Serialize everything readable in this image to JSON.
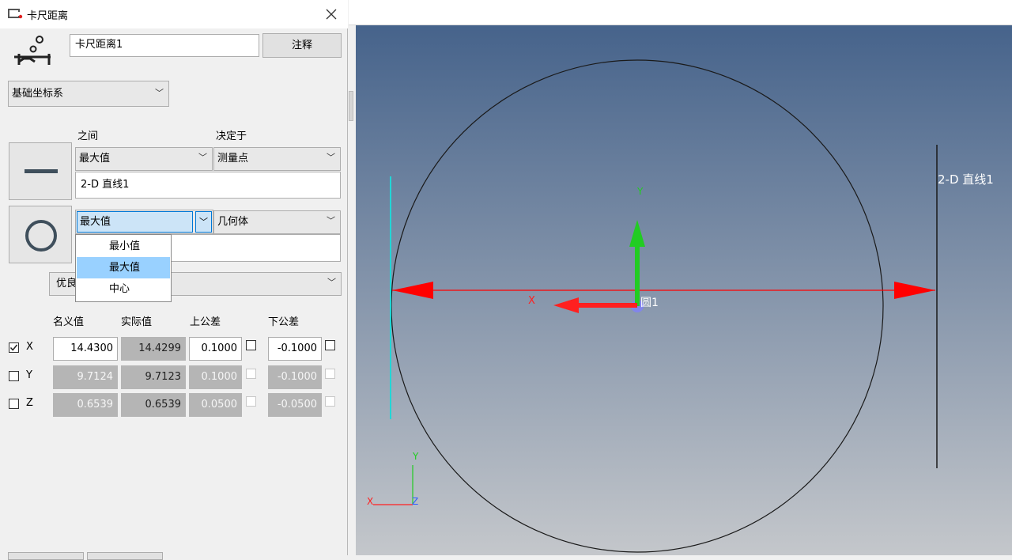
{
  "dialog": {
    "title": "卡尺距离",
    "name_value": "卡尺距离1",
    "annotation_button": "注释",
    "coord_system": "基础坐标系",
    "col_between": "之间",
    "col_determined_by": "决定于",
    "feature1": {
      "between": "最大值",
      "determined": "测量点",
      "name": "2-D 直线1"
    },
    "feature2": {
      "between": "最大值",
      "determined": "几何体"
    },
    "dropdown_options": [
      "最小值",
      "最大值",
      "中心"
    ],
    "dropdown_selected_index": 1,
    "quality_combo": "优良",
    "table": {
      "headers": [
        "名义值",
        "实际值",
        "上公差",
        "下公差"
      ],
      "rows": [
        {
          "axis": "X",
          "checked": true,
          "nominal": "14.4300",
          "actual": "14.4299",
          "upper": "0.1000",
          "lower": "-0.1000"
        },
        {
          "axis": "Y",
          "checked": false,
          "nominal": "9.7124",
          "actual": "9.7123",
          "upper": "0.1000",
          "lower": "-0.1000"
        },
        {
          "axis": "Z",
          "checked": false,
          "nominal": "0.6539",
          "actual": "0.6539",
          "upper": "0.0500",
          "lower": "-0.0500"
        }
      ]
    }
  },
  "viewport": {
    "line_label": "2-D 直线1",
    "circle_label": "圆1",
    "axis_x": "X",
    "axis_y": "Y",
    "axis_z": "Z",
    "colors": {
      "dimension": "#ff0000",
      "y_axis": "#22cc22",
      "x_axis": "#ff2020",
      "edge_line": "#22d6d6",
      "accent": "#99d1ff"
    }
  }
}
